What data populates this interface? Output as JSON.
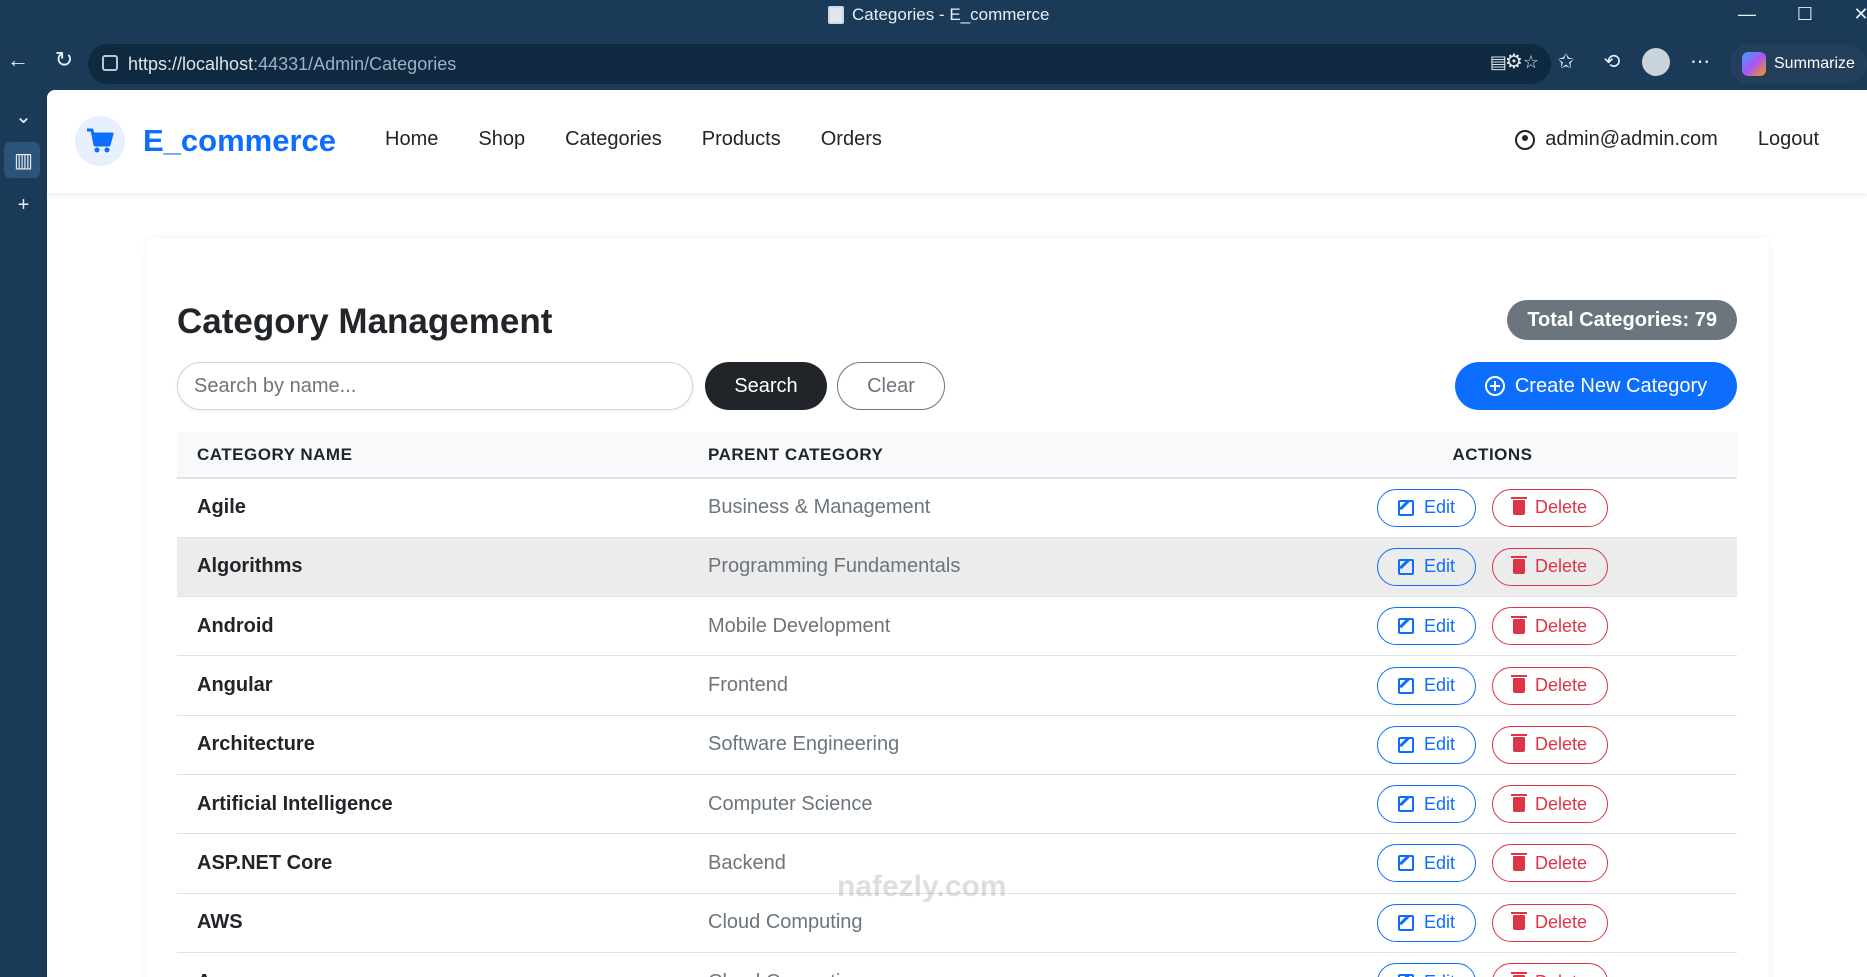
{
  "browser": {
    "window_title": "Categories - E_commerce",
    "url_host": "https://localhost",
    "url_path": ":44331/Admin/Categories",
    "summarize_label": "Summarize"
  },
  "site": {
    "brand": "E_commerce",
    "nav": [
      "Home",
      "Shop",
      "Categories",
      "Products",
      "Orders"
    ],
    "user_email": "admin@admin.com",
    "logout": "Logout"
  },
  "main": {
    "title": "Category Management",
    "total_badge": "Total Categories: 79",
    "search_placeholder": "Search by name...",
    "search_button": "Search",
    "clear_button": "Clear",
    "create_button": "Create New Category",
    "columns": [
      "CATEGORY NAME",
      "PARENT CATEGORY",
      "ACTIONS"
    ],
    "edit_label": "Edit",
    "delete_label": "Delete",
    "rows": [
      {
        "name": "Agile",
        "parent": "Business & Management"
      },
      {
        "name": "Algorithms",
        "parent": "Programming Fundamentals"
      },
      {
        "name": "Android",
        "parent": "Mobile Development"
      },
      {
        "name": "Angular",
        "parent": "Frontend"
      },
      {
        "name": "Architecture",
        "parent": "Software Engineering"
      },
      {
        "name": "Artificial Intelligence",
        "parent": "Computer Science"
      },
      {
        "name": "ASP.NET Core",
        "parent": "Backend"
      },
      {
        "name": "AWS",
        "parent": "Cloud Computing"
      },
      {
        "name": "Azure",
        "parent": "Cloud Computing"
      }
    ]
  },
  "watermark": "nafezly.com",
  "colors": {
    "primary": "#0d6efd",
    "danger": "#dc3545",
    "dark": "#212529",
    "badge": "#6c757d",
    "chrome": "#1b3a57"
  }
}
